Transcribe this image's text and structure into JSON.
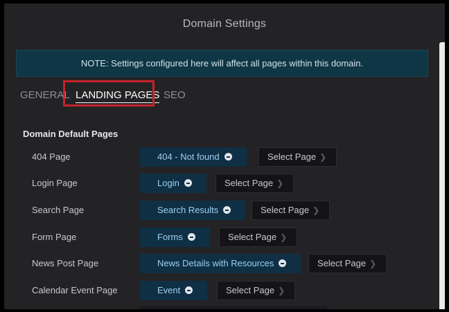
{
  "dialog": {
    "title": "Domain Settings",
    "note": "NOTE: Settings configured here will affect all pages within this domain."
  },
  "tabs": [
    {
      "label": "GENERAL",
      "active": false
    },
    {
      "label": "LANDING PAGES",
      "active": true
    },
    {
      "label": "SEO",
      "active": false
    }
  ],
  "section": {
    "title": "Domain Default Pages"
  },
  "select_label": "Select Page",
  "rows": [
    {
      "label": "404 Page",
      "value": "404 - Not found"
    },
    {
      "label": "Login Page",
      "value": "Login"
    },
    {
      "label": "Search Page",
      "value": "Search Results"
    },
    {
      "label": "Form Page",
      "value": "Forms"
    },
    {
      "label": "News Post Page",
      "value": "News Details with Resources"
    },
    {
      "label": "Calendar Event Page",
      "value": "Event"
    }
  ],
  "colors": {
    "accent_highlight": "#c4242b",
    "note_bg": "#0e3645",
    "chip_bg": "#0f2f45",
    "chip_text": "#9ed0f0"
  },
  "icons": {
    "remove": "minus-circle-icon",
    "chevron": "chevron-right-icon"
  }
}
